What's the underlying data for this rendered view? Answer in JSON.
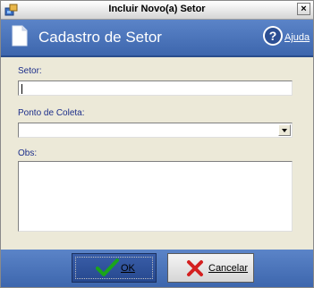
{
  "window": {
    "title": "Incluir Novo(a) Setor",
    "close_label": "×"
  },
  "header": {
    "title": "Cadastro de Setor",
    "help_label": "Ajuda",
    "icons": [
      "document-icon",
      "help-icon"
    ]
  },
  "form": {
    "setor_label": "Setor:",
    "setor_value": "",
    "ponto_label": "Ponto de Coleta:",
    "ponto_value": "",
    "obs_label": "Obs:",
    "obs_value": ""
  },
  "buttons": {
    "ok_label": "OK",
    "cancel_label": "Cancelar"
  },
  "colors": {
    "header_blue": "#4a72b8",
    "label_blue": "#1c2e8a",
    "ok_check": "#1aa51a",
    "cancel_x": "#d42020"
  }
}
